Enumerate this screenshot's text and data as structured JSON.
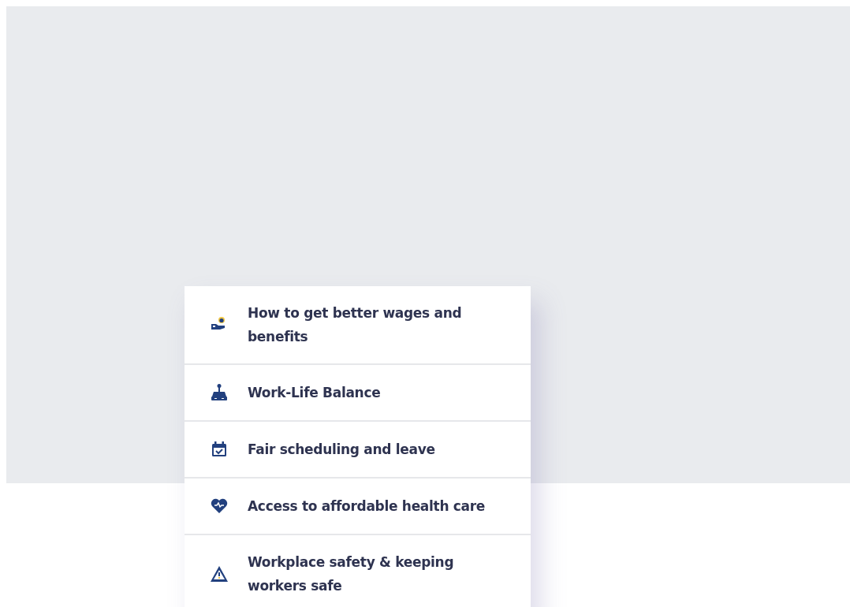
{
  "menu": {
    "items": [
      {
        "label": "How to get better wages and benefits",
        "kind": "wages"
      },
      {
        "label": "Work-Life Balance",
        "kind": "balance"
      },
      {
        "label": "Fair scheduling and leave",
        "kind": "calendar"
      },
      {
        "label": "Access to affordable health care",
        "kind": "health"
      },
      {
        "label": "Workplace safety & keeping workers safe",
        "kind": "warning"
      }
    ]
  }
}
